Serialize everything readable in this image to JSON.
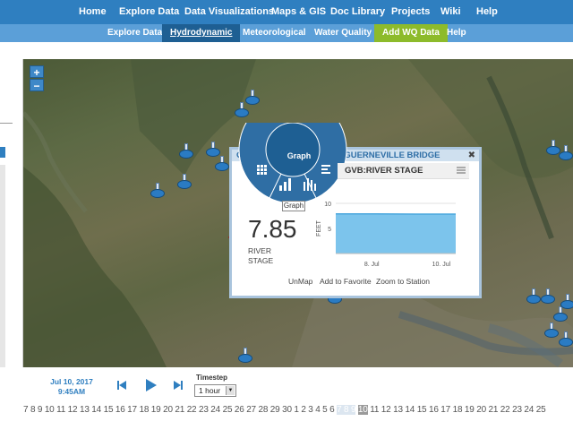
{
  "top_nav": [
    "Home",
    "Explore Data",
    "Data Visualizations",
    "Maps & GIS",
    "Doc Library",
    "Projects",
    "Wiki",
    "Help"
  ],
  "sub_nav": [
    "Explore Data",
    "Hydrodynamic",
    "Meteorological",
    "Water Quality",
    "Add WQ Data",
    "Help"
  ],
  "sub_nav_active": "Hydrodynamic",
  "map": {
    "zoom_in": "+",
    "zoom_out": "−"
  },
  "popup": {
    "title": "GVB - RUSSIAN RIVER AT GUERNEVILLE BRIDGE",
    "close": "✖",
    "subtitle": "GVB:RIVER STAGE",
    "radial_label": "Graph",
    "radial_tooltip": "Graph",
    "value": "7.85",
    "value_label_1": "RIVER",
    "value_label_2": "STAGE",
    "links": [
      "UnMap",
      "Add to Favorite",
      "Zoom to Station"
    ]
  },
  "chart_data": {
    "type": "area",
    "x": [
      "9. Jul",
      "9.5 Jul",
      "10. Jul",
      "10.5 Jul"
    ],
    "x_ticks": [
      "8. Jul",
      "10. Jul"
    ],
    "y_ticks": [
      "10",
      "5"
    ],
    "ylabel": "FEET",
    "ylim": [
      0,
      10
    ],
    "values": [
      7.9,
      7.9,
      7.85,
      7.85
    ],
    "color": "#7cc4ec"
  },
  "player": {
    "date": "Jul 10, 2017",
    "time": "9:45AM",
    "timestep_label": "Timestep",
    "timestep_value": "1 hour",
    "timestep_arrow": "▼"
  },
  "timeline": {
    "before": "7 8 9 10 11 12 13 14 15 16 17 18 19 20 21 22 23 24 25 26 27 28 29 30 1  2  3  4  5  6",
    "highlight": "7 8 9",
    "current": "10",
    "after": "11 12 13 14 15 16 17 18 19 20 21 22 23 24 25"
  },
  "colors": {
    "nav": "#2f7fc0",
    "subnav": "#5b9fd8",
    "active": "#1e5f93",
    "addwq": "#8dbb2b"
  }
}
